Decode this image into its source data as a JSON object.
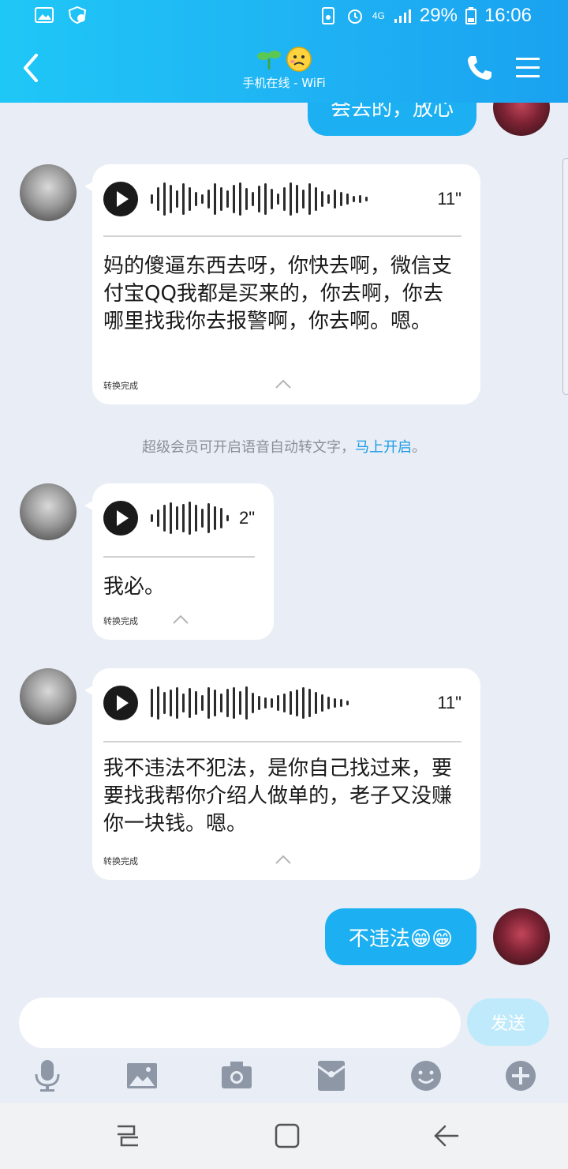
{
  "status_bar": {
    "network": "4G",
    "battery": "29%",
    "time": "16:06"
  },
  "header": {
    "subtitle": "手机在线 - WiFi"
  },
  "messages": {
    "top_out_text": "会去的，放心",
    "voice1": {
      "duration": "11\"",
      "text": "妈的傻逼东西去呀，你快去啊，微信支付宝QQ我都是买来的，你去啊，你去哪里找我你去报警啊，你去啊。嗯。",
      "status": "转换完成"
    },
    "notice": {
      "text": "超级会员可开启语音自动转文字，",
      "link": "马上开启",
      "tail": "。"
    },
    "voice2": {
      "duration": "2\"",
      "text": "我必。",
      "status": "转换完成"
    },
    "voice3": {
      "duration": "11\"",
      "text": "我不违法不犯法，是你自己找过来，要要找我帮你介绍人做单的，老子又没赚你一块钱。嗯。",
      "status": "转换完成"
    },
    "last_out_text": "不违法😁😁"
  },
  "composer": {
    "input_value": "",
    "send_label": "发送"
  },
  "toolbar": {
    "icons": [
      "microphone-icon",
      "image-icon",
      "camera-icon",
      "red-packet-icon",
      "emoji-icon",
      "plus-icon"
    ]
  },
  "colors": {
    "header": "#1fb4f4",
    "bubble_out": "#1cb0f2",
    "bubble_in": "#ffffff",
    "background": "#e9edf5",
    "link": "#1a9ce8"
  }
}
